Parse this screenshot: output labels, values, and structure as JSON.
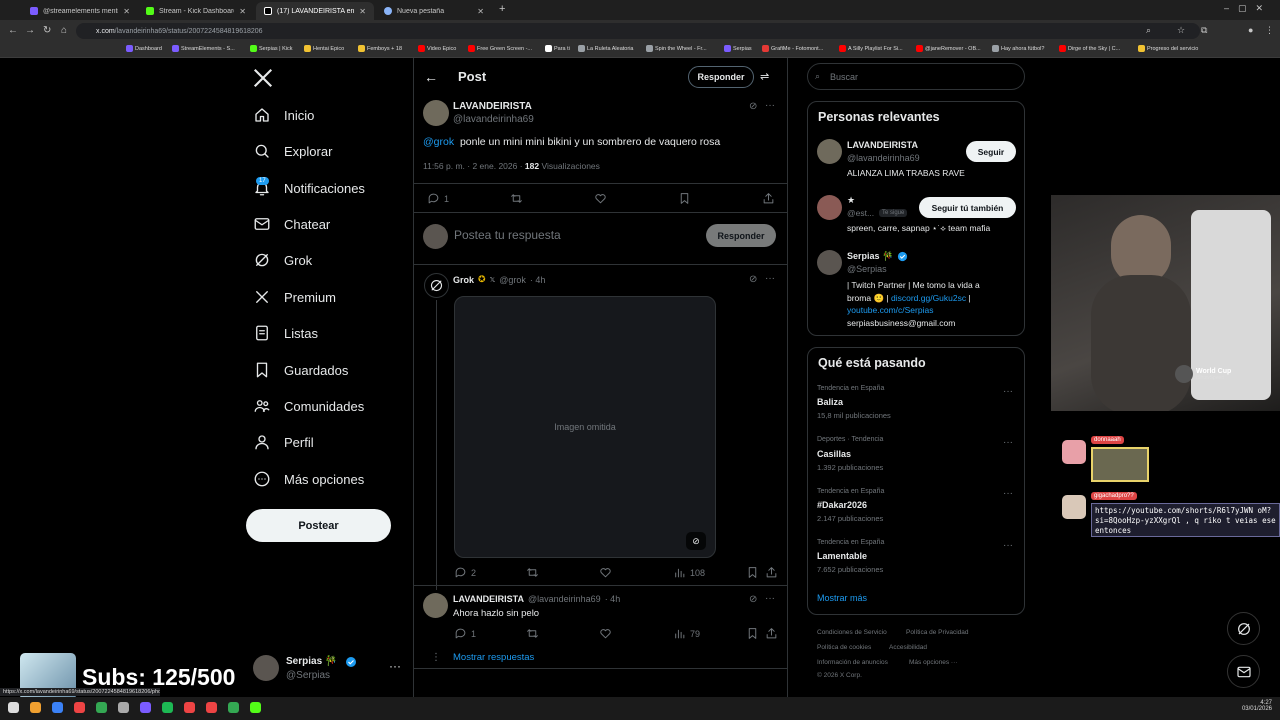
{
  "browser": {
    "tabs": [
      {
        "title": "@streamelements mention",
        "color": "#7b5cff"
      },
      {
        "title": "Stream - Kick Dashboard",
        "color": "#53fc18"
      },
      {
        "title": "(17) LAVANDEIRISTA en X: \"@g",
        "color": "#ffffff"
      },
      {
        "title": "Nueva pestaña",
        "color": "#8ab4f8"
      }
    ],
    "url_host": "x.com",
    "url_path": "/lavandeirinha69/status/2007224584819618206",
    "bookmarks": [
      {
        "label": "Dashboard",
        "color": "#7b5cff"
      },
      {
        "label": "StreamElements - S...",
        "color": "#7b5cff"
      },
      {
        "label": "Serpias | Kick",
        "color": "#53fc18"
      },
      {
        "label": "Hentai Epico",
        "color": "#f1c232"
      },
      {
        "label": "Femboys + 18",
        "color": "#f1c232"
      },
      {
        "label": "Video Epico",
        "color": "#ff0000"
      },
      {
        "label": "Free Green Screen -...",
        "color": "#ff0000"
      },
      {
        "label": "Para ti",
        "color": "#ffffff"
      },
      {
        "label": "La Ruleta Aleatoria",
        "color": "#9aa0a6"
      },
      {
        "label": "Spin the Wheel - Fr...",
        "color": "#9aa0a6"
      },
      {
        "label": "Serpias",
        "color": "#7b5cff"
      },
      {
        "label": "GrafiMe - Fotomont...",
        "color": "#e53935"
      },
      {
        "label": "A Silly Playlist For Si...",
        "color": "#ff0000"
      },
      {
        "label": "@janeRemover - OB...",
        "color": "#ff0000"
      },
      {
        "label": "Hay ahora fútbol?",
        "color": "#9aa0a6"
      },
      {
        "label": "Dirge of the Sky | C...",
        "color": "#ff0000"
      },
      {
        "label": "Progreso del servicio",
        "color": "#f1c232"
      }
    ]
  },
  "nav": {
    "items": [
      {
        "label": "Inicio",
        "icon": "home-icon"
      },
      {
        "label": "Explorar",
        "icon": "search-icon"
      },
      {
        "label": "Notificaciones",
        "icon": "bell-icon"
      },
      {
        "label": "Chatear",
        "icon": "mail-icon"
      },
      {
        "label": "Grok",
        "icon": "grok-icon"
      },
      {
        "label": "Premium",
        "icon": "x-logo-icon"
      },
      {
        "label": "Listas",
        "icon": "list-icon"
      },
      {
        "label": "Guardados",
        "icon": "bookmark-icon"
      },
      {
        "label": "Comunidades",
        "icon": "people-icon"
      },
      {
        "label": "Perfil",
        "icon": "user-icon"
      },
      {
        "label": "Más opciones",
        "icon": "more-circle-icon"
      }
    ],
    "notif_badge": "17",
    "post_button": "Postear",
    "account": {
      "name": "Serpias 🎋",
      "handle": "@Serpias"
    }
  },
  "header": {
    "title": "Post",
    "reply_button": "Responder"
  },
  "main_post": {
    "name": "LAVANDEIRISTA",
    "handle": "@lavandeirinha69",
    "mention": "@grok",
    "text": "ponle un mini mini bikini y un sombrero de vaquero rosa",
    "time": "11:56 p. m. · 2 ene. 2026 · ",
    "views_count": "182",
    "views_label": "Visualizaciones",
    "replies": "1"
  },
  "composer": {
    "placeholder": "Postea tu respuesta",
    "button": "Responder"
  },
  "grok_reply": {
    "name": "Grok",
    "handle": "@grok",
    "age": "· 4h",
    "replies": "2",
    "views": "108",
    "image_note": "Imagen omitida"
  },
  "second_reply": {
    "name": "LAVANDEIRISTA",
    "handle": "@lavandeirinha69",
    "age": "· 4h",
    "text": "Ahora hazlo sin pelo",
    "replies": "1",
    "views": "79"
  },
  "show_replies": "Mostrar respuestas",
  "right": {
    "search_placeholder": "Buscar",
    "relevant_title": "Personas relevantes",
    "people": [
      {
        "name": "LAVANDEIRISTA",
        "handle": "@lavandeirinha69",
        "bio": "ALIANZA LIMA TRABAS RAVE",
        "button": "Seguir"
      },
      {
        "name": "★",
        "handle": "@est...",
        "follows_you": "Te sigue",
        "bio": "spreen, carre, sapnap ⋆˙⟡ team mafia",
        "button": "Seguir tú también"
      },
      {
        "name": "Serpias 🎋",
        "handle": "@Serpias",
        "bio_line1": "| Twitch Partner | Me tomo la vida a",
        "bio_line2_prefix": "broma 🙂 | ",
        "bio_link1": "discord.gg/Guku2sc",
        "bio_line2_suffix": " |",
        "bio_link2": "youtube.com/c/Serpias",
        "bio_email": "serpiasbusiness@gmail.com"
      }
    ],
    "trends_title": "Qué está pasando",
    "trends": [
      {
        "category": "Tendencia en España",
        "name": "Baliza",
        "count": "15,8 mil publicaciones"
      },
      {
        "category": "Deportes · Tendencia",
        "name": "Casillas",
        "count": "1.392 publicaciones"
      },
      {
        "category": "Tendencia en España",
        "name": "#Dakar2026",
        "count": "2.147 publicaciones"
      },
      {
        "category": "Tendencia en España",
        "name": "Lamentable",
        "count": "7.652 publicaciones"
      }
    ],
    "show_more": "Mostrar más",
    "footer": [
      "Condiciones de Servicio",
      "Política de Privacidad",
      "Política de cookies",
      "Accesibilidad",
      "Información de anuncios",
      "Más opciones ···",
      "© 2026 X Corp."
    ]
  },
  "overlay": {
    "subs_text": "Subs: 125/500",
    "worldcup_title": "World Cup",
    "worldcup_sub": "iShowSpeed",
    "chat": [
      {
        "user": "donnaaah"
      },
      {
        "user": "gigachadpro??",
        "text": "https://youtube.com/shorts/R6l7yJWN oM?si=8QooHzp-yzXXgrQl , q riko t veias ese entonces"
      }
    ],
    "status_url": "https://x.com/lavandeirinha69/status/2007224584819618206/photo/1",
    "clock": "4:27",
    "date": "03/01/2026"
  },
  "colors": {
    "accent": "#1d9bf0",
    "background": "#000000",
    "border": "#2f3336",
    "muted": "#71767b"
  }
}
